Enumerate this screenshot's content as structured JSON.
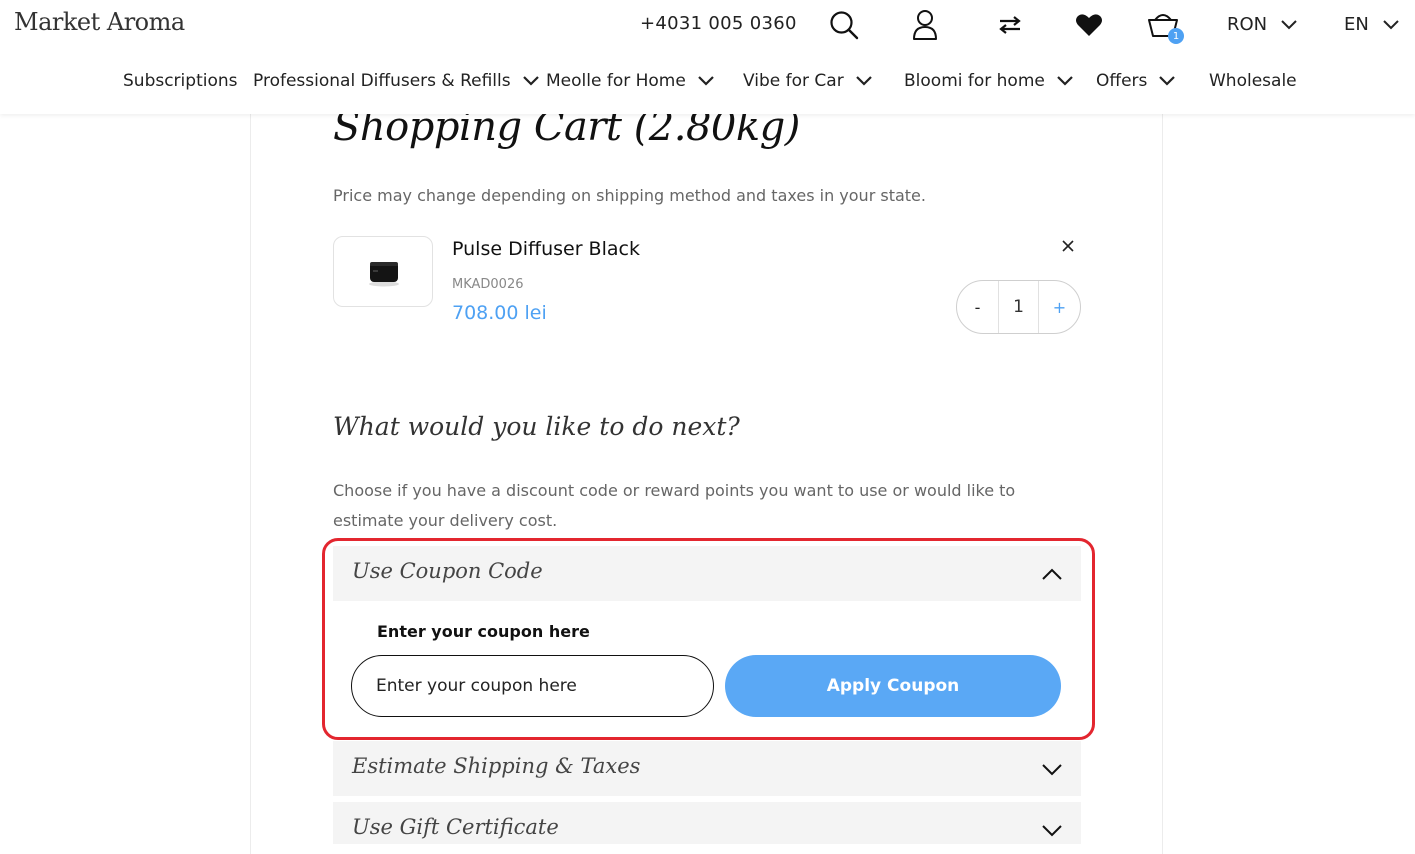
{
  "header": {
    "logo": "Market Aroma",
    "phone": "+4031 005 0360",
    "cart_count": "1",
    "currency": "RON",
    "language": "EN",
    "icons": [
      "search-icon",
      "user-icon",
      "compare-icon",
      "heart-icon",
      "cart-icon"
    ]
  },
  "nav": {
    "items": [
      {
        "label": "Subscriptions",
        "has_dropdown": false
      },
      {
        "label": "Professional Diffusers & Refills",
        "has_dropdown": true
      },
      {
        "label": "Meolle for Home",
        "has_dropdown": true
      },
      {
        "label": "Vibe for Car",
        "has_dropdown": true
      },
      {
        "label": "Bloomi for home",
        "has_dropdown": true
      },
      {
        "label": "Offers",
        "has_dropdown": true
      },
      {
        "label": "Wholesale",
        "has_dropdown": false
      }
    ]
  },
  "cart": {
    "title": "Shopping Cart  (2.80kg)",
    "price_note": "Price may change depending on shipping method and taxes in your state.",
    "items": [
      {
        "name": "Pulse Diffuser Black",
        "sku": "MKAD0026",
        "price": "708.00 lei",
        "quantity": "1",
        "minus_label": "-",
        "plus_label": "+"
      }
    ]
  },
  "next": {
    "title": "What would you like to do next?",
    "description": "Choose if you have a discount code or reward points you want to use or would like to estimate your delivery cost."
  },
  "accordion": {
    "coupon": {
      "title": "Use Coupon Code",
      "expanded": true,
      "label": "Enter your coupon here",
      "placeholder": "Enter your coupon here",
      "button": "Apply Coupon"
    },
    "shipping": {
      "title": "Estimate Shipping & Taxes",
      "expanded": false
    },
    "gift": {
      "title": "Use Gift Certificate",
      "expanded": false
    }
  },
  "colors": {
    "accent": "#4ea1f3",
    "button": "#5aa8f5",
    "highlight": "#e3262f"
  }
}
